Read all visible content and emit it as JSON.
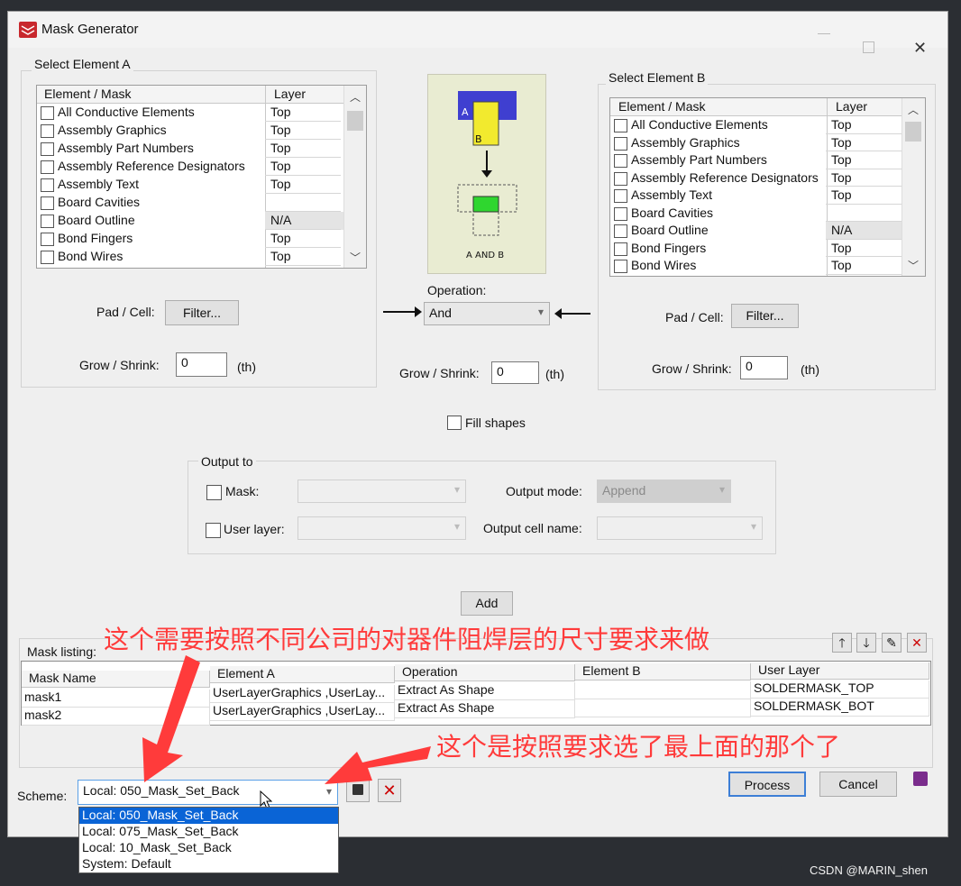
{
  "window": {
    "title": "Mask Generator"
  },
  "element_a": {
    "group_label": "Select Element A",
    "col_element": "Element / Mask",
    "col_layer": "Layer",
    "rows": [
      {
        "name": "All Conductive Elements",
        "layer": "Top"
      },
      {
        "name": "Assembly Graphics",
        "layer": "Top"
      },
      {
        "name": "Assembly Part Numbers",
        "layer": "Top"
      },
      {
        "name": "Assembly Reference Designators",
        "layer": "Top"
      },
      {
        "name": "Assembly Text",
        "layer": "Top"
      },
      {
        "name": "Board Cavities",
        "layer": ""
      },
      {
        "name": "Board Outline",
        "layer": "N/A"
      },
      {
        "name": "Bond Fingers",
        "layer": "Top"
      },
      {
        "name": "Bond Wires",
        "layer": "Top"
      }
    ],
    "pad_cell_label": "Pad / Cell:",
    "filter_label": "Filter...",
    "grow_label": "Grow / Shrink:",
    "grow_value": "0",
    "unit": "(th)"
  },
  "element_b": {
    "group_label": "Select Element B",
    "col_element": "Element / Mask",
    "col_layer": "Layer",
    "rows": [
      {
        "name": "All Conductive Elements",
        "layer": "Top"
      },
      {
        "name": "Assembly Graphics",
        "layer": "Top"
      },
      {
        "name": "Assembly Part Numbers",
        "layer": "Top"
      },
      {
        "name": "Assembly Reference Designators",
        "layer": "Top"
      },
      {
        "name": "Assembly Text",
        "layer": "Top"
      },
      {
        "name": "Board Cavities",
        "layer": ""
      },
      {
        "name": "Board Outline",
        "layer": "N/A"
      },
      {
        "name": "Bond Fingers",
        "layer": "Top"
      },
      {
        "name": "Bond Wires",
        "layer": "Top"
      }
    ],
    "pad_cell_label": "Pad / Cell:",
    "filter_label": "Filter...",
    "grow_label": "Grow / Shrink:",
    "grow_value": "0",
    "unit": "(th)"
  },
  "preview": {
    "label_a": "A",
    "label_b": "B",
    "caption": "A AND B",
    "colors": {
      "a": "#3f3fd0",
      "b": "#f2ea2e",
      "result": "#2fd62f",
      "bg": "#e9ecd2"
    }
  },
  "operation": {
    "label": "Operation:",
    "value": "And",
    "grow_label": "Grow / Shrink:",
    "grow_value": "0",
    "unit": "(th)"
  },
  "fill_shapes_label": "Fill shapes",
  "output": {
    "group_label": "Output to",
    "mask_label": "Mask:",
    "user_layer_label": "User layer:",
    "mode_label": "Output mode:",
    "mode_value": "Append",
    "cell_name_label": "Output cell name:"
  },
  "add_label": "Add",
  "mask_listing": {
    "label": "Mask listing:",
    "columns": [
      "Mask Name",
      "Element A",
      "Operation",
      "Element B",
      "User Layer"
    ],
    "rows": [
      {
        "name": "mask1",
        "element_a": "UserLayerGraphics ,UserLay...",
        "operation": "Extract As Shape",
        "element_b": "",
        "user_layer": "SOLDERMASK_TOP"
      },
      {
        "name": "mask2",
        "element_a": "UserLayerGraphics ,UserLay...",
        "operation": "Extract As Shape",
        "element_b": "",
        "user_layer": "SOLDERMASK_BOT"
      }
    ]
  },
  "scheme": {
    "label": "Scheme:",
    "value": "Local: 050_Mask_Set_Back",
    "options": [
      "Local: 050_Mask_Set_Back",
      "Local: 075_Mask_Set_Back",
      "Local: 10_Mask_Set_Back",
      "System: Default"
    ]
  },
  "buttons": {
    "process": "Process",
    "cancel": "Cancel"
  },
  "annotations": {
    "top": "这个需要按照不同公司的对器件阻焊层的尺寸要求来做",
    "bottom": "这个是按照要求选了最上面的那个了",
    "color": "#ff3b3b"
  },
  "watermark": "CSDN @MARIN_shen"
}
